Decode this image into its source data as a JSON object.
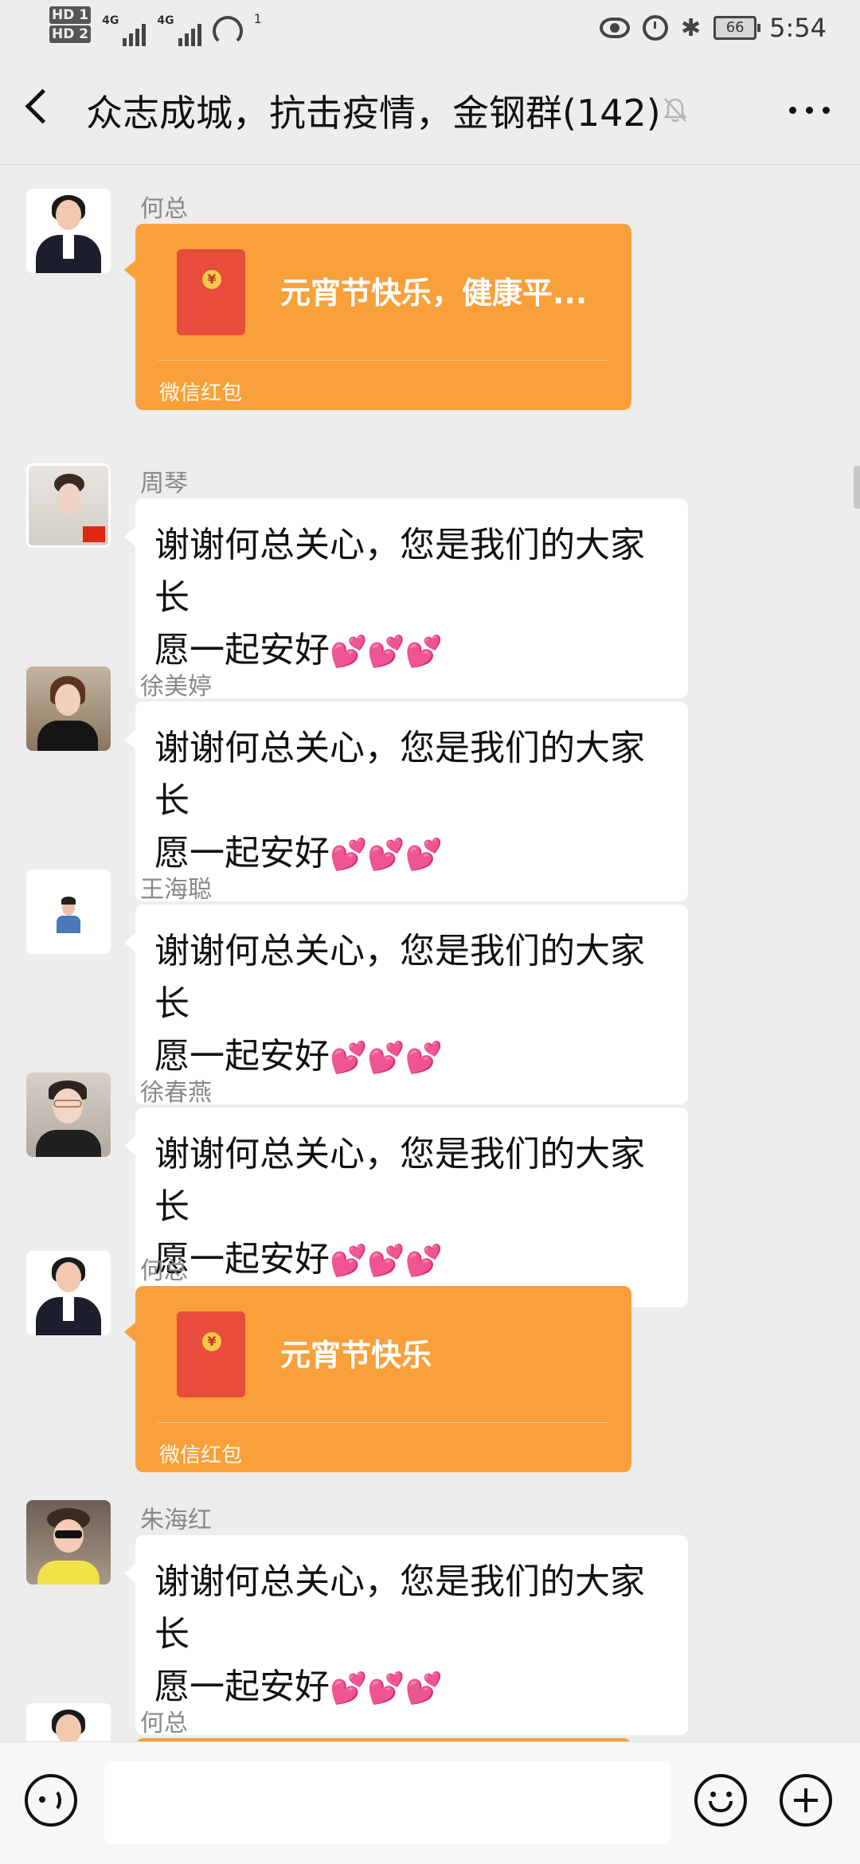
{
  "status_bar": {
    "hd1": "HD 1",
    "hd2": "HD 2",
    "sig1": "4G",
    "sig2": "4G",
    "hotspot_count": "1",
    "battery": "66",
    "time": "5:54"
  },
  "header": {
    "title": "众志成城，抗击疫情，金钢群(142)"
  },
  "messages": [
    {
      "type": "red_packet",
      "sender": "何总",
      "text": "元宵节快乐，健康平...",
      "label": "微信红包"
    },
    {
      "type": "text",
      "sender": "周琴",
      "line1": "谢谢何总关心，您是我们的大家长",
      "line2": "愿一起安好",
      "emoji": "💕💕💕"
    },
    {
      "type": "text",
      "sender": "徐美婷",
      "line1": "谢谢何总关心，您是我们的大家长",
      "line2": "愿一起安好",
      "emoji": "💕💕💕"
    },
    {
      "type": "text",
      "sender": "王海聪",
      "line1": "谢谢何总关心，您是我们的大家长",
      "line2": "愿一起安好",
      "emoji": "💕💕💕"
    },
    {
      "type": "text",
      "sender": "徐春燕",
      "line1": "谢谢何总关心，您是我们的大家长",
      "line2": "愿一起安好",
      "emoji": "💕💕💕"
    },
    {
      "type": "red_packet",
      "sender": "何总",
      "text": "元宵节快乐",
      "label": "微信红包"
    },
    {
      "type": "text",
      "sender": "朱海红",
      "line1": "谢谢何总关心，您是我们的大家长",
      "line2": "愿一起安好",
      "emoji": "💕💕💕"
    },
    {
      "type": "partial",
      "sender": "何总"
    }
  ],
  "input_bar": {
    "voice_icon": "voice-icon",
    "emoji_icon": "emoji-icon",
    "plus_icon": "plus-icon"
  },
  "colors": {
    "red_packet": "#f8a03a",
    "background": "#ededed"
  }
}
